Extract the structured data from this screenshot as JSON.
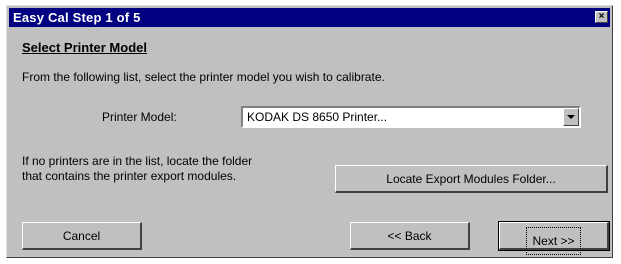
{
  "window": {
    "title": "Easy Cal Step 1 of 5",
    "close_glyph": "×"
  },
  "section": {
    "heading": "Select Printer Model",
    "instruction": "From the following list, select the printer model you wish to calibrate."
  },
  "printer_model": {
    "label": "Printer Model:",
    "selected_value": "KODAK DS 8650 Printer..."
  },
  "help": {
    "line1": "If no printers are in the list, locate the folder",
    "line2": "that contains the printer export modules."
  },
  "buttons": {
    "locate": "Locate Export Modules Folder...",
    "cancel": "Cancel",
    "back": "<< Back",
    "next": "Next >>"
  }
}
